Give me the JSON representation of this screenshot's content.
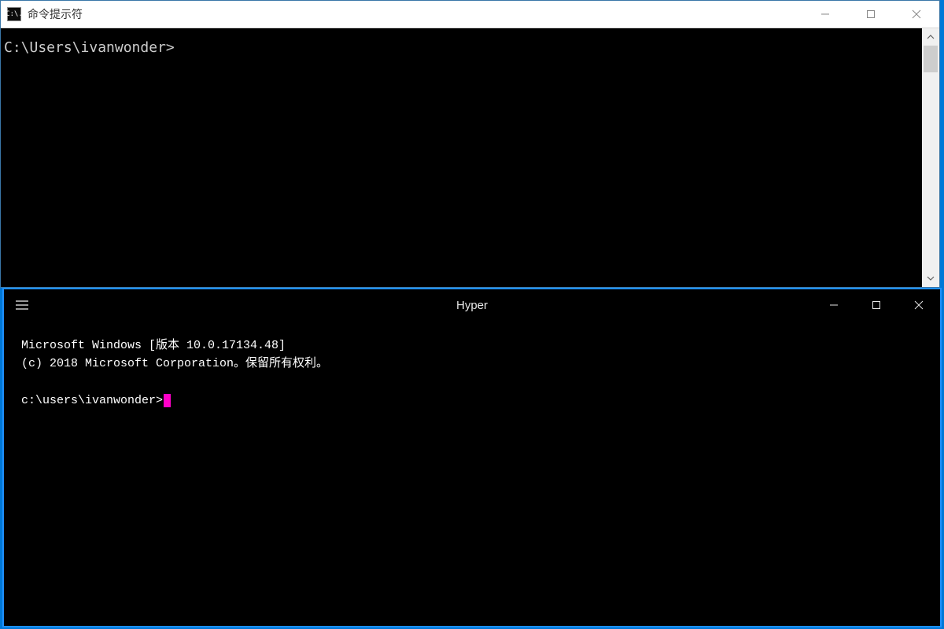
{
  "cmd": {
    "title": "命令提示符",
    "icon_text": "C:\\.",
    "prompt": "C:\\Users\\ivanwonder>"
  },
  "hyper": {
    "title": "Hyper",
    "body_line1": "Microsoft Windows [版本 10.0.17134.48]",
    "body_line2": "(c) 2018 Microsoft Corporation。保留所有权利。",
    "prompt": "c:\\users\\ivanwonder>"
  }
}
